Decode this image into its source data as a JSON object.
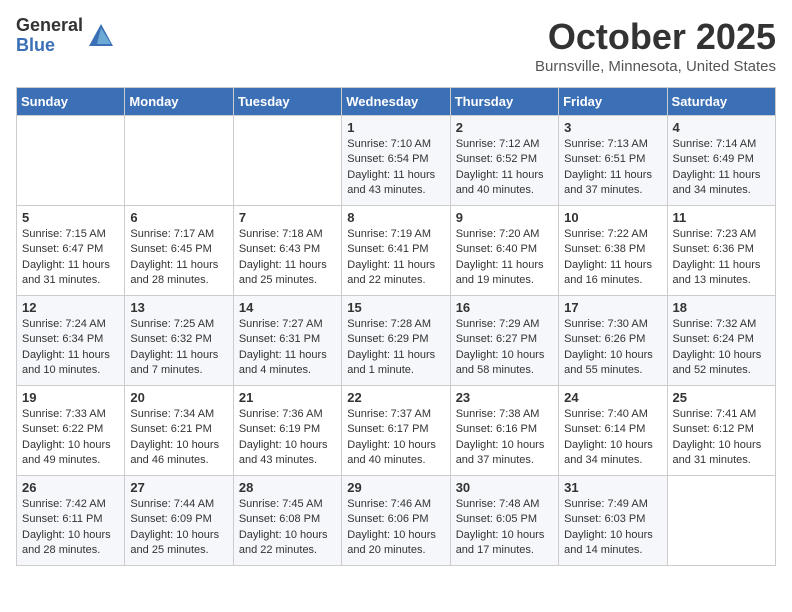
{
  "header": {
    "logo_general": "General",
    "logo_blue": "Blue",
    "month_title": "October 2025",
    "location": "Burnsville, Minnesota, United States"
  },
  "weekdays": [
    "Sunday",
    "Monday",
    "Tuesday",
    "Wednesday",
    "Thursday",
    "Friday",
    "Saturday"
  ],
  "weeks": [
    [
      {
        "day": "",
        "sunrise": "",
        "sunset": "",
        "daylight": ""
      },
      {
        "day": "",
        "sunrise": "",
        "sunset": "",
        "daylight": ""
      },
      {
        "day": "",
        "sunrise": "",
        "sunset": "",
        "daylight": ""
      },
      {
        "day": "1",
        "sunrise": "Sunrise: 7:10 AM",
        "sunset": "Sunset: 6:54 PM",
        "daylight": "Daylight: 11 hours and 43 minutes."
      },
      {
        "day": "2",
        "sunrise": "Sunrise: 7:12 AM",
        "sunset": "Sunset: 6:52 PM",
        "daylight": "Daylight: 11 hours and 40 minutes."
      },
      {
        "day": "3",
        "sunrise": "Sunrise: 7:13 AM",
        "sunset": "Sunset: 6:51 PM",
        "daylight": "Daylight: 11 hours and 37 minutes."
      },
      {
        "day": "4",
        "sunrise": "Sunrise: 7:14 AM",
        "sunset": "Sunset: 6:49 PM",
        "daylight": "Daylight: 11 hours and 34 minutes."
      }
    ],
    [
      {
        "day": "5",
        "sunrise": "Sunrise: 7:15 AM",
        "sunset": "Sunset: 6:47 PM",
        "daylight": "Daylight: 11 hours and 31 minutes."
      },
      {
        "day": "6",
        "sunrise": "Sunrise: 7:17 AM",
        "sunset": "Sunset: 6:45 PM",
        "daylight": "Daylight: 11 hours and 28 minutes."
      },
      {
        "day": "7",
        "sunrise": "Sunrise: 7:18 AM",
        "sunset": "Sunset: 6:43 PM",
        "daylight": "Daylight: 11 hours and 25 minutes."
      },
      {
        "day": "8",
        "sunrise": "Sunrise: 7:19 AM",
        "sunset": "Sunset: 6:41 PM",
        "daylight": "Daylight: 11 hours and 22 minutes."
      },
      {
        "day": "9",
        "sunrise": "Sunrise: 7:20 AM",
        "sunset": "Sunset: 6:40 PM",
        "daylight": "Daylight: 11 hours and 19 minutes."
      },
      {
        "day": "10",
        "sunrise": "Sunrise: 7:22 AM",
        "sunset": "Sunset: 6:38 PM",
        "daylight": "Daylight: 11 hours and 16 minutes."
      },
      {
        "day": "11",
        "sunrise": "Sunrise: 7:23 AM",
        "sunset": "Sunset: 6:36 PM",
        "daylight": "Daylight: 11 hours and 13 minutes."
      }
    ],
    [
      {
        "day": "12",
        "sunrise": "Sunrise: 7:24 AM",
        "sunset": "Sunset: 6:34 PM",
        "daylight": "Daylight: 11 hours and 10 minutes."
      },
      {
        "day": "13",
        "sunrise": "Sunrise: 7:25 AM",
        "sunset": "Sunset: 6:32 PM",
        "daylight": "Daylight: 11 hours and 7 minutes."
      },
      {
        "day": "14",
        "sunrise": "Sunrise: 7:27 AM",
        "sunset": "Sunset: 6:31 PM",
        "daylight": "Daylight: 11 hours and 4 minutes."
      },
      {
        "day": "15",
        "sunrise": "Sunrise: 7:28 AM",
        "sunset": "Sunset: 6:29 PM",
        "daylight": "Daylight: 11 hours and 1 minute."
      },
      {
        "day": "16",
        "sunrise": "Sunrise: 7:29 AM",
        "sunset": "Sunset: 6:27 PM",
        "daylight": "Daylight: 10 hours and 58 minutes."
      },
      {
        "day": "17",
        "sunrise": "Sunrise: 7:30 AM",
        "sunset": "Sunset: 6:26 PM",
        "daylight": "Daylight: 10 hours and 55 minutes."
      },
      {
        "day": "18",
        "sunrise": "Sunrise: 7:32 AM",
        "sunset": "Sunset: 6:24 PM",
        "daylight": "Daylight: 10 hours and 52 minutes."
      }
    ],
    [
      {
        "day": "19",
        "sunrise": "Sunrise: 7:33 AM",
        "sunset": "Sunset: 6:22 PM",
        "daylight": "Daylight: 10 hours and 49 minutes."
      },
      {
        "day": "20",
        "sunrise": "Sunrise: 7:34 AM",
        "sunset": "Sunset: 6:21 PM",
        "daylight": "Daylight: 10 hours and 46 minutes."
      },
      {
        "day": "21",
        "sunrise": "Sunrise: 7:36 AM",
        "sunset": "Sunset: 6:19 PM",
        "daylight": "Daylight: 10 hours and 43 minutes."
      },
      {
        "day": "22",
        "sunrise": "Sunrise: 7:37 AM",
        "sunset": "Sunset: 6:17 PM",
        "daylight": "Daylight: 10 hours and 40 minutes."
      },
      {
        "day": "23",
        "sunrise": "Sunrise: 7:38 AM",
        "sunset": "Sunset: 6:16 PM",
        "daylight": "Daylight: 10 hours and 37 minutes."
      },
      {
        "day": "24",
        "sunrise": "Sunrise: 7:40 AM",
        "sunset": "Sunset: 6:14 PM",
        "daylight": "Daylight: 10 hours and 34 minutes."
      },
      {
        "day": "25",
        "sunrise": "Sunrise: 7:41 AM",
        "sunset": "Sunset: 6:12 PM",
        "daylight": "Daylight: 10 hours and 31 minutes."
      }
    ],
    [
      {
        "day": "26",
        "sunrise": "Sunrise: 7:42 AM",
        "sunset": "Sunset: 6:11 PM",
        "daylight": "Daylight: 10 hours and 28 minutes."
      },
      {
        "day": "27",
        "sunrise": "Sunrise: 7:44 AM",
        "sunset": "Sunset: 6:09 PM",
        "daylight": "Daylight: 10 hours and 25 minutes."
      },
      {
        "day": "28",
        "sunrise": "Sunrise: 7:45 AM",
        "sunset": "Sunset: 6:08 PM",
        "daylight": "Daylight: 10 hours and 22 minutes."
      },
      {
        "day": "29",
        "sunrise": "Sunrise: 7:46 AM",
        "sunset": "Sunset: 6:06 PM",
        "daylight": "Daylight: 10 hours and 20 minutes."
      },
      {
        "day": "30",
        "sunrise": "Sunrise: 7:48 AM",
        "sunset": "Sunset: 6:05 PM",
        "daylight": "Daylight: 10 hours and 17 minutes."
      },
      {
        "day": "31",
        "sunrise": "Sunrise: 7:49 AM",
        "sunset": "Sunset: 6:03 PM",
        "daylight": "Daylight: 10 hours and 14 minutes."
      },
      {
        "day": "",
        "sunrise": "",
        "sunset": "",
        "daylight": ""
      }
    ]
  ]
}
